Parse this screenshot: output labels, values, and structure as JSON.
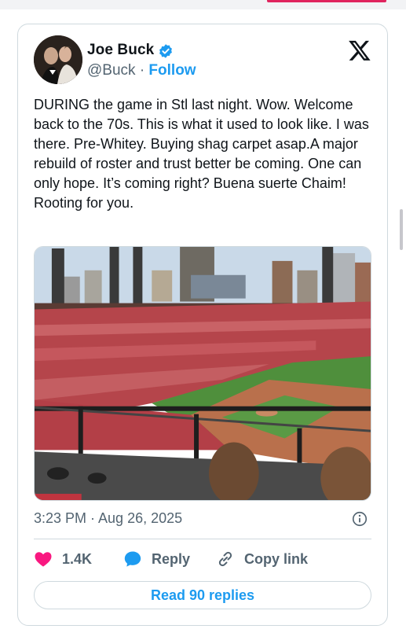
{
  "author": {
    "name": "Joe Buck",
    "handle": "@Buck",
    "separator": "·",
    "follow_label": "Follow"
  },
  "tweet": {
    "text": "DURING the game in Stl last night. Wow. Welcome back to the 70s. This is what it used to look like. I was there. Pre-Whitey. Buying shag carpet asap.A major rebuild of roster and trust better be coming. One can only hope. It’s coming right? Buena suerte Chaim! Rooting for you.",
    "timestamp": "3:23 PM · Aug 26, 2025"
  },
  "actions": {
    "likes": "1.4K",
    "reply_label": "Reply",
    "copy_link_label": "Copy link"
  },
  "read_replies_label": "Read 90 replies",
  "colors": {
    "accent": "#1d9bf0",
    "like": "#f91880",
    "text": "#0f1419",
    "muted": "#536471",
    "border": "#cfd9de"
  },
  "icons": [
    "verified-badge-icon",
    "x-logo-icon",
    "info-icon",
    "heart-icon",
    "reply-bubble-icon",
    "link-icon"
  ]
}
